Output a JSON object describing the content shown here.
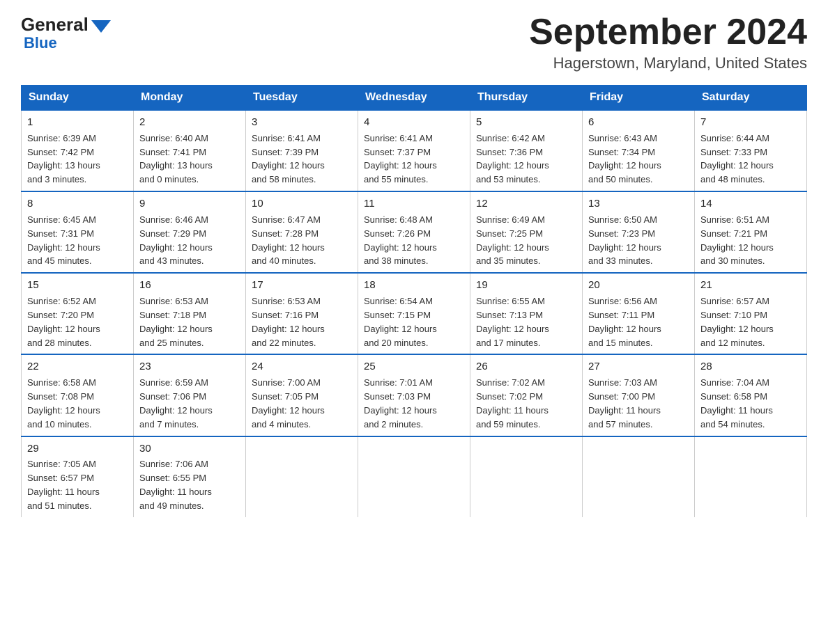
{
  "logo": {
    "general": "General",
    "blue": "Blue"
  },
  "header": {
    "month": "September 2024",
    "location": "Hagerstown, Maryland, United States"
  },
  "weekdays": [
    "Sunday",
    "Monday",
    "Tuesday",
    "Wednesday",
    "Thursday",
    "Friday",
    "Saturday"
  ],
  "weeks": [
    [
      {
        "day": "1",
        "sunrise": "6:39 AM",
        "sunset": "7:42 PM",
        "daylight": "13 hours and 3 minutes."
      },
      {
        "day": "2",
        "sunrise": "6:40 AM",
        "sunset": "7:41 PM",
        "daylight": "13 hours and 0 minutes."
      },
      {
        "day": "3",
        "sunrise": "6:41 AM",
        "sunset": "7:39 PM",
        "daylight": "12 hours and 58 minutes."
      },
      {
        "day": "4",
        "sunrise": "6:41 AM",
        "sunset": "7:37 PM",
        "daylight": "12 hours and 55 minutes."
      },
      {
        "day": "5",
        "sunrise": "6:42 AM",
        "sunset": "7:36 PM",
        "daylight": "12 hours and 53 minutes."
      },
      {
        "day": "6",
        "sunrise": "6:43 AM",
        "sunset": "7:34 PM",
        "daylight": "12 hours and 50 minutes."
      },
      {
        "day": "7",
        "sunrise": "6:44 AM",
        "sunset": "7:33 PM",
        "daylight": "12 hours and 48 minutes."
      }
    ],
    [
      {
        "day": "8",
        "sunrise": "6:45 AM",
        "sunset": "7:31 PM",
        "daylight": "12 hours and 45 minutes."
      },
      {
        "day": "9",
        "sunrise": "6:46 AM",
        "sunset": "7:29 PM",
        "daylight": "12 hours and 43 minutes."
      },
      {
        "day": "10",
        "sunrise": "6:47 AM",
        "sunset": "7:28 PM",
        "daylight": "12 hours and 40 minutes."
      },
      {
        "day": "11",
        "sunrise": "6:48 AM",
        "sunset": "7:26 PM",
        "daylight": "12 hours and 38 minutes."
      },
      {
        "day": "12",
        "sunrise": "6:49 AM",
        "sunset": "7:25 PM",
        "daylight": "12 hours and 35 minutes."
      },
      {
        "day": "13",
        "sunrise": "6:50 AM",
        "sunset": "7:23 PM",
        "daylight": "12 hours and 33 minutes."
      },
      {
        "day": "14",
        "sunrise": "6:51 AM",
        "sunset": "7:21 PM",
        "daylight": "12 hours and 30 minutes."
      }
    ],
    [
      {
        "day": "15",
        "sunrise": "6:52 AM",
        "sunset": "7:20 PM",
        "daylight": "12 hours and 28 minutes."
      },
      {
        "day": "16",
        "sunrise": "6:53 AM",
        "sunset": "7:18 PM",
        "daylight": "12 hours and 25 minutes."
      },
      {
        "day": "17",
        "sunrise": "6:53 AM",
        "sunset": "7:16 PM",
        "daylight": "12 hours and 22 minutes."
      },
      {
        "day": "18",
        "sunrise": "6:54 AM",
        "sunset": "7:15 PM",
        "daylight": "12 hours and 20 minutes."
      },
      {
        "day": "19",
        "sunrise": "6:55 AM",
        "sunset": "7:13 PM",
        "daylight": "12 hours and 17 minutes."
      },
      {
        "day": "20",
        "sunrise": "6:56 AM",
        "sunset": "7:11 PM",
        "daylight": "12 hours and 15 minutes."
      },
      {
        "day": "21",
        "sunrise": "6:57 AM",
        "sunset": "7:10 PM",
        "daylight": "12 hours and 12 minutes."
      }
    ],
    [
      {
        "day": "22",
        "sunrise": "6:58 AM",
        "sunset": "7:08 PM",
        "daylight": "12 hours and 10 minutes."
      },
      {
        "day": "23",
        "sunrise": "6:59 AM",
        "sunset": "7:06 PM",
        "daylight": "12 hours and 7 minutes."
      },
      {
        "day": "24",
        "sunrise": "7:00 AM",
        "sunset": "7:05 PM",
        "daylight": "12 hours and 4 minutes."
      },
      {
        "day": "25",
        "sunrise": "7:01 AM",
        "sunset": "7:03 PM",
        "daylight": "12 hours and 2 minutes."
      },
      {
        "day": "26",
        "sunrise": "7:02 AM",
        "sunset": "7:02 PM",
        "daylight": "11 hours and 59 minutes."
      },
      {
        "day": "27",
        "sunrise": "7:03 AM",
        "sunset": "7:00 PM",
        "daylight": "11 hours and 57 minutes."
      },
      {
        "day": "28",
        "sunrise": "7:04 AM",
        "sunset": "6:58 PM",
        "daylight": "11 hours and 54 minutes."
      }
    ],
    [
      {
        "day": "29",
        "sunrise": "7:05 AM",
        "sunset": "6:57 PM",
        "daylight": "11 hours and 51 minutes."
      },
      {
        "day": "30",
        "sunrise": "7:06 AM",
        "sunset": "6:55 PM",
        "daylight": "11 hours and 49 minutes."
      },
      null,
      null,
      null,
      null,
      null
    ]
  ],
  "labels": {
    "sunrise": "Sunrise: ",
    "sunset": "Sunset: ",
    "daylight": "Daylight: "
  }
}
